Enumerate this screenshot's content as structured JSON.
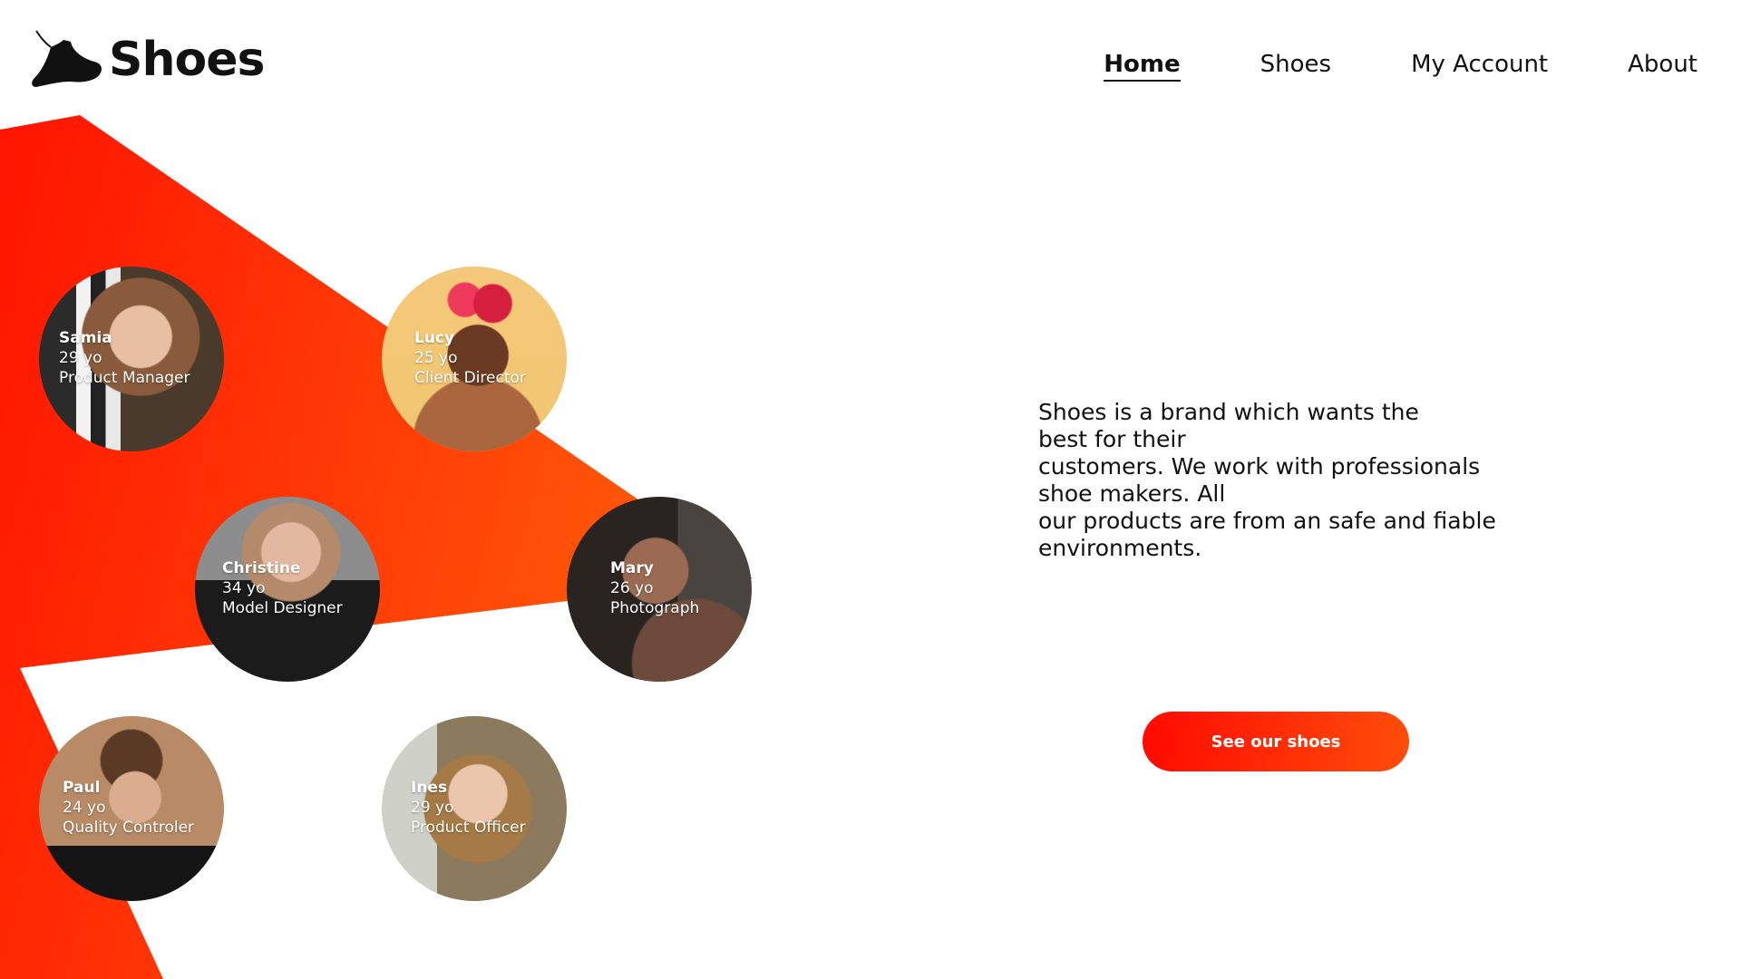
{
  "brand": {
    "name": "Shoes",
    "logo_icon": "shoe-icon"
  },
  "nav": {
    "items": [
      {
        "label": "Home",
        "active": true
      },
      {
        "label": "Shoes",
        "active": false
      },
      {
        "label": "My Account",
        "active": false
      },
      {
        "label": "About",
        "active": false
      }
    ]
  },
  "team": [
    {
      "name": "Samia",
      "age": "29 yo",
      "role": "Product Manager"
    },
    {
      "name": "Lucy",
      "age": "25 yo",
      "role": "Client Director"
    },
    {
      "name": "Christine",
      "age": "34 yo",
      "role": "Model Designer"
    },
    {
      "name": "Mary",
      "age": "26 yo",
      "role": "Photograph"
    },
    {
      "name": "Paul",
      "age": "24 yo",
      "role": "Quality Controler"
    },
    {
      "name": "Ines",
      "age": "29 yo",
      "role": "Product Officer"
    }
  ],
  "about": {
    "lines": [
      "Shoes is a brand which wants the",
      "best for their",
      "customers. We work with professionals",
      "shoe makers. All",
      "our products are from an safe and fiable",
      "environments."
    ]
  },
  "cta": {
    "label": "See our shoes"
  },
  "colors": {
    "accent": "#ff1a00",
    "accent_light": "#ff5a0a",
    "text": "#111111"
  }
}
